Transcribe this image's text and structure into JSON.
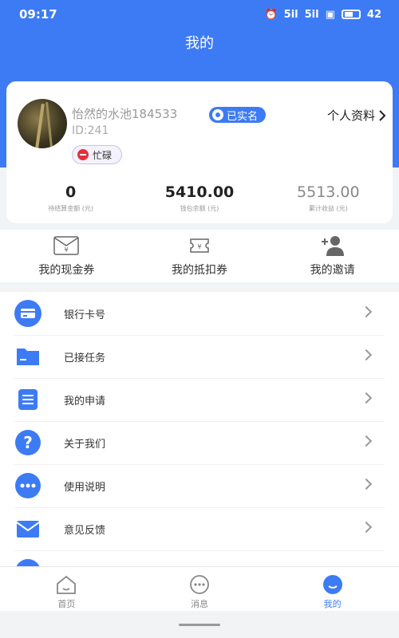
{
  "status_bar": {
    "time": "09:17",
    "signal_1": "5il",
    "signal_2": "5il",
    "battery": "42"
  },
  "page": {
    "title": "我的"
  },
  "profile": {
    "username": "怡然的水池184533",
    "verified_label": "已实名",
    "profile_link": "个人资料",
    "user_id": "ID:241",
    "status_label": "忙碌"
  },
  "stats": [
    {
      "value": "0",
      "label": "待结算金额 (元)"
    },
    {
      "value": "5410.00",
      "label": "钱包余额 (元)"
    },
    {
      "value": "5513.00",
      "label": "累计收益 (元)"
    }
  ],
  "quick_actions": [
    {
      "label": "我的现金券",
      "icon": "cash-voucher-icon"
    },
    {
      "label": "我的抵扣券",
      "icon": "deduction-coupon-icon"
    },
    {
      "label": "我的邀请",
      "icon": "invite-user-icon"
    }
  ],
  "menu": [
    {
      "label": "银行卡号",
      "icon": "bank-card-icon"
    },
    {
      "label": "已接任务",
      "icon": "folder-icon"
    },
    {
      "label": "我的申请",
      "icon": "list-icon"
    },
    {
      "label": "关于我们",
      "icon": "question-icon"
    },
    {
      "label": "使用说明",
      "icon": "more-dots-icon"
    },
    {
      "label": "意见反馈",
      "icon": "mail-icon"
    }
  ],
  "tabs": [
    {
      "label": "首页",
      "icon": "home-icon"
    },
    {
      "label": "消息",
      "icon": "message-icon"
    },
    {
      "label": "我的",
      "icon": "profile-icon",
      "active": true
    }
  ],
  "colors": {
    "primary": "#3d7bf5",
    "background": "#f2f3f5",
    "busy": "#e0323c"
  }
}
